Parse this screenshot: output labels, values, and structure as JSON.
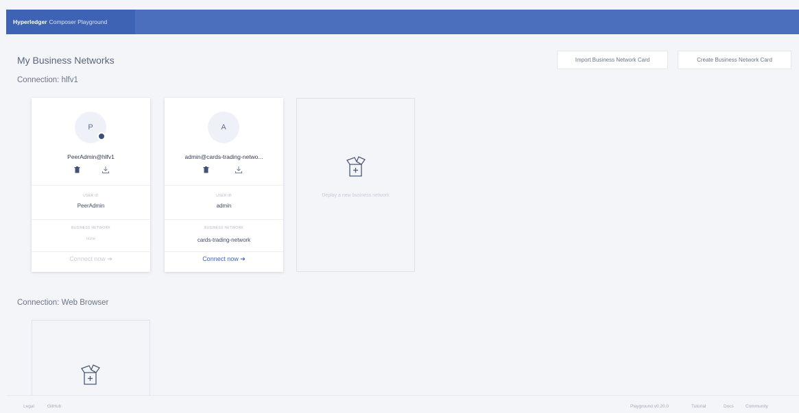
{
  "header": {
    "brand_bold": "Hyperledger",
    "brand_rest": "Composer Playground"
  },
  "main": {
    "title": "My Business Networks",
    "import_button": "Import Business Network Card",
    "create_button": "Create Business Network Card",
    "connections": [
      {
        "title": "Connection: hlfv1",
        "cards": [
          {
            "avatar_letter": "P",
            "name": "PeerAdmin@hlfv1",
            "userid_label": "USER ID",
            "userid": "PeerAdmin",
            "network_label": "BUSINESS NETWORK",
            "network": "none",
            "connect": "Connect now"
          },
          {
            "avatar_letter": "A",
            "name": "admin@cards-trading-netwo...",
            "userid_label": "USER ID",
            "userid": "admin",
            "network_label": "BUSINESS NETWORK",
            "network": "cards-trading-network",
            "connect": "Connect now"
          }
        ],
        "deploy_text": "Deploy a new business network"
      },
      {
        "title": "Connection: Web Browser"
      }
    ]
  },
  "footer": {
    "left": [
      "Legal",
      "GitHub"
    ],
    "right": [
      "Playground v0.20.0",
      "Tutorial",
      "Docs",
      "Community"
    ]
  },
  "colors": {
    "header": "#4c6fbd",
    "brand_block": "#3e63b4",
    "accent": "#3e63b4"
  },
  "icons": {
    "delete": "trash-icon",
    "export": "download-icon",
    "deploy": "package-plus-icon",
    "connect": "arrow-right-icon",
    "badge": "admin-badge-icon"
  }
}
